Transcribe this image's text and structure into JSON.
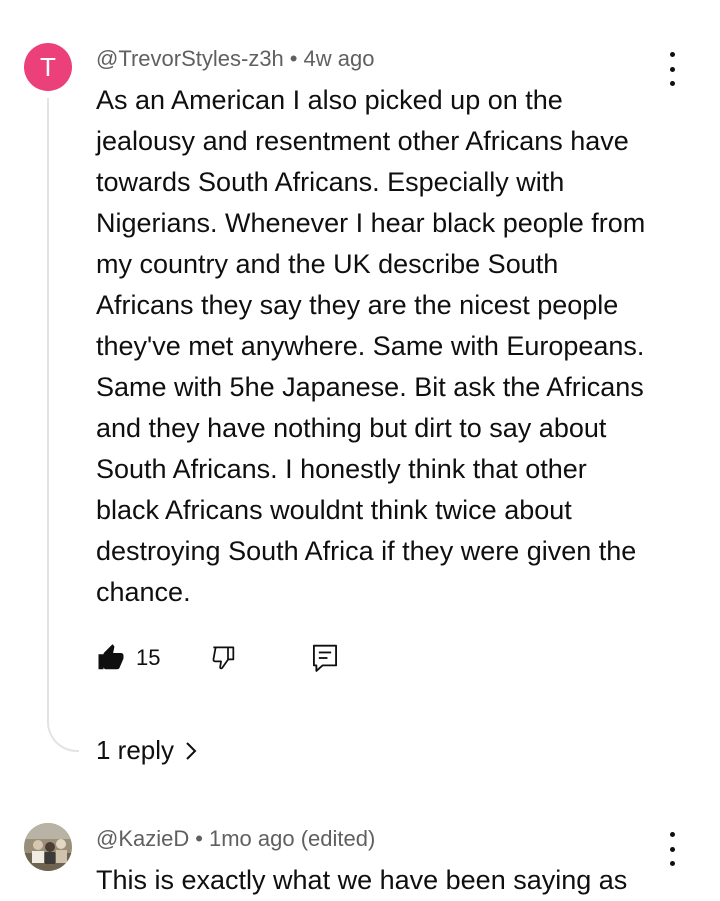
{
  "comments": [
    {
      "avatar_letter": "T",
      "author": "@TrevorStyles-z3h",
      "time": "4w ago",
      "text": "As an American I also picked up on the\njealousy and resentment other Africans have\ntowards South Africans. Especially with\nNigerians. Whenever I hear black people from\nmy country and the UK describe South\nAfricans they say they are the nicest people\nthey've met anywhere. Same with Europeans.\nSame with 5he Japanese. Bit ask the Africans\nand they have nothing but dirt to say about\nSouth Africans. I honestly think that other\nblack Africans wouldnt think twice about\ndestroying South Africa if they were given the\nchance.",
      "likes": "15",
      "replies_label": "1 reply"
    },
    {
      "author": "@KazieD",
      "time": "1mo ago (edited)",
      "text": "This is exactly what we have been saying as"
    }
  ],
  "meta_separator": "•",
  "icons": {
    "like": "thumbs-up-filled-icon",
    "dislike": "thumbs-down-outline-icon",
    "reply": "comment-reply-icon",
    "more": "more-vert-icon",
    "chevron": "chevron-right-icon"
  },
  "colors": {
    "avatar_bg": "#ec407a",
    "meta_text": "#606060",
    "body_text": "#0f0f0f",
    "thread_line": "#e3e3e3"
  }
}
